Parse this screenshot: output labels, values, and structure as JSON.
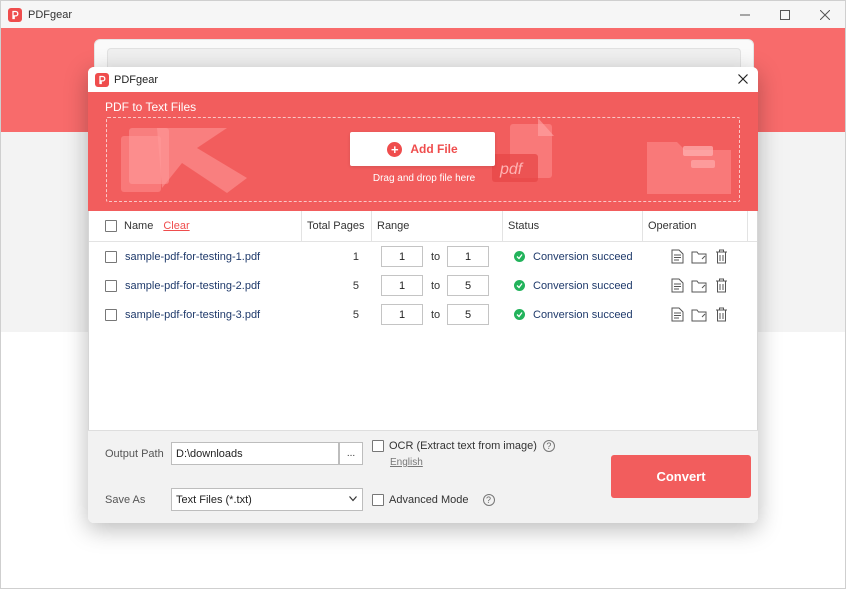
{
  "app": {
    "title": "PDFgear",
    "window_controls": {
      "minimize": "—",
      "maximize": "☐",
      "close": "✕"
    }
  },
  "dialog": {
    "title": "PDFgear",
    "close_label": "✕",
    "banner_title": "PDF to Text Files",
    "add_file_label": "Add File",
    "drag_hint": "Drag and drop file here",
    "decor_pdf_text": "pdf"
  },
  "table": {
    "headers": {
      "name": "Name",
      "clear": "Clear",
      "total_pages": "Total Pages",
      "range": "Range",
      "status": "Status",
      "operation": "Operation"
    },
    "to_label": "to",
    "rows": [
      {
        "name": "sample-pdf-for-testing-1.pdf",
        "pages": "1",
        "from": "1",
        "to": "1",
        "status": "Conversion succeed"
      },
      {
        "name": "sample-pdf-for-testing-2.pdf",
        "pages": "5",
        "from": "1",
        "to": "5",
        "status": "Conversion succeed"
      },
      {
        "name": "sample-pdf-for-testing-3.pdf",
        "pages": "5",
        "from": "1",
        "to": "5",
        "status": "Conversion succeed"
      }
    ]
  },
  "footer": {
    "output_path_label": "Output Path",
    "output_path_value": "D:\\downloads",
    "browse_label": "...",
    "save_as_label": "Save As",
    "save_as_value": "Text Files (*.txt)",
    "ocr_label": "OCR (Extract text from image)",
    "ocr_language": "English",
    "advanced_label": "Advanced Mode",
    "help_label": "?",
    "convert_label": "Convert"
  },
  "colors": {
    "accent": "#f25d5d",
    "success": "#22b35b",
    "link": "#1f3a6b"
  }
}
